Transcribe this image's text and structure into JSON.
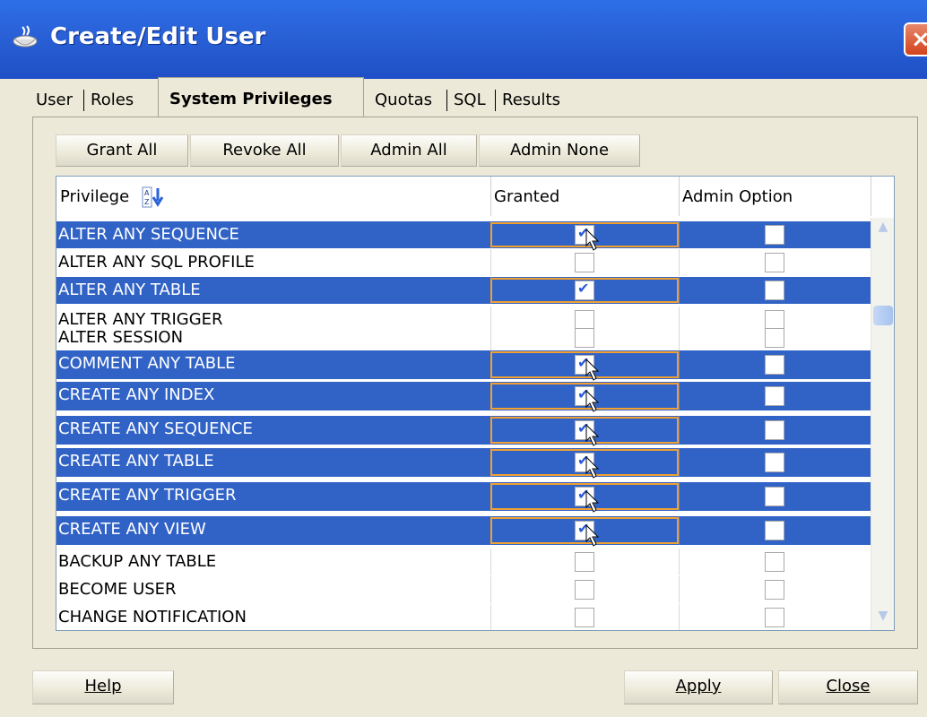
{
  "window": {
    "title": "Create/Edit User",
    "close_glyph": "×"
  },
  "tabs": [
    {
      "label": "User",
      "active": false
    },
    {
      "label": "Roles",
      "active": false
    },
    {
      "label": "System Privileges",
      "active": true
    },
    {
      "label": "Quotas",
      "active": false
    },
    {
      "label": "SQL",
      "active": false
    },
    {
      "label": "Results",
      "active": false
    }
  ],
  "toolbar": {
    "grant_all": "Grant All",
    "revoke_all": "Revoke All",
    "admin_all": "Admin All",
    "admin_none": "Admin None"
  },
  "table": {
    "columns": {
      "privilege": "Privilege",
      "granted": "Granted",
      "admin_option": "Admin Option"
    },
    "sort_icon": "sort-az-icon",
    "rows": [
      {
        "name": "ALTER ANY SEQUENCE",
        "selected": true,
        "granted": true,
        "admin": false
      },
      {
        "name": "ALTER ANY SQL PROFILE",
        "selected": false,
        "granted": false,
        "admin": false
      },
      {
        "name": "ALTER ANY TABLE",
        "selected": true,
        "granted": true,
        "admin": false
      },
      {
        "name": "ALTER ANY TRIGGER",
        "selected": false,
        "granted": false,
        "admin": false
      },
      {
        "name": "ALTER SESSION",
        "selected": false,
        "granted": false,
        "admin": false
      },
      {
        "name": "COMMENT ANY TABLE",
        "selected": true,
        "granted": true,
        "admin": false
      },
      {
        "name": "CREATE ANY INDEX",
        "selected": true,
        "granted": true,
        "admin": false
      },
      {
        "name": "CREATE ANY SEQUENCE",
        "selected": true,
        "granted": true,
        "admin": false
      },
      {
        "name": "CREATE ANY TABLE",
        "selected": true,
        "granted": true,
        "admin": false
      },
      {
        "name": "CREATE ANY TRIGGER",
        "selected": true,
        "granted": true,
        "admin": false
      },
      {
        "name": "CREATE ANY VIEW",
        "selected": true,
        "granted": true,
        "admin": false
      },
      {
        "name": "BACKUP ANY TABLE",
        "selected": false,
        "granted": false,
        "admin": false
      },
      {
        "name": "BECOME USER",
        "selected": false,
        "granted": false,
        "admin": false
      },
      {
        "name": "CHANGE NOTIFICATION",
        "selected": false,
        "granted": false,
        "admin": false
      }
    ]
  },
  "footer": {
    "help": "Help",
    "apply": "Apply",
    "close": "Close"
  },
  "colors": {
    "selection": "#3163c7",
    "title_bar": "#2a62d8",
    "focus_border": "#f0a030"
  }
}
